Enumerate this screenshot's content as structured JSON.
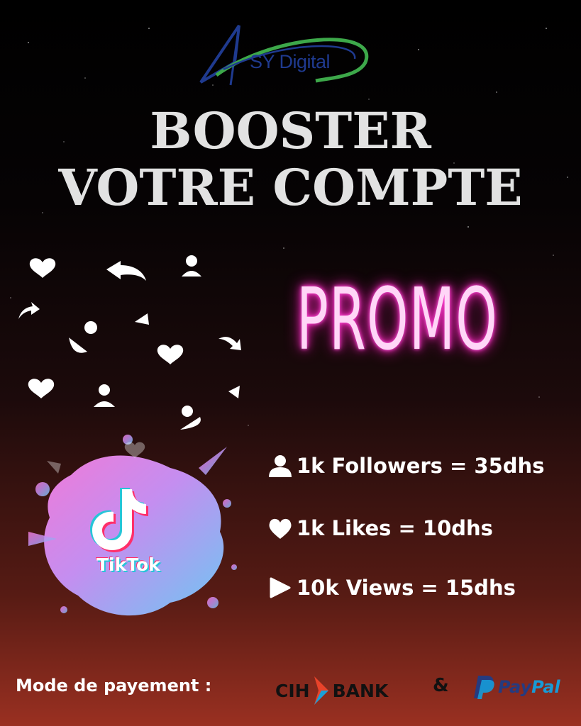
{
  "brand": {
    "name": "SY Digital"
  },
  "headline": {
    "line1": "BOOSTER",
    "line2": "VOTRE COMPTE"
  },
  "promo": "PROMO",
  "platform": {
    "name": "TikTok",
    "icon": "tiktok-logo-icon"
  },
  "prices": [
    {
      "icon": "user-icon",
      "label": "1k Followers = 35dhs"
    },
    {
      "icon": "heart-icon",
      "label": "1k Likes = 10dhs"
    },
    {
      "icon": "play-icon",
      "label": "10k Views = 15dhs"
    }
  ],
  "payment": {
    "label": "Mode de payement :",
    "bank_left": "CIH",
    "bank_right": "BANK",
    "separator": "&",
    "paypal_left": "Pay",
    "paypal_right": "Pal"
  },
  "colors": {
    "promo_neon": "#ff2fc8",
    "headline": "#e2e2e2",
    "cih_chevron": "#e9432a",
    "paypal_dark": "#253b80",
    "paypal_light": "#179bd7",
    "logo_blue": "#1f3a8f",
    "logo_green": "#3da84a"
  }
}
